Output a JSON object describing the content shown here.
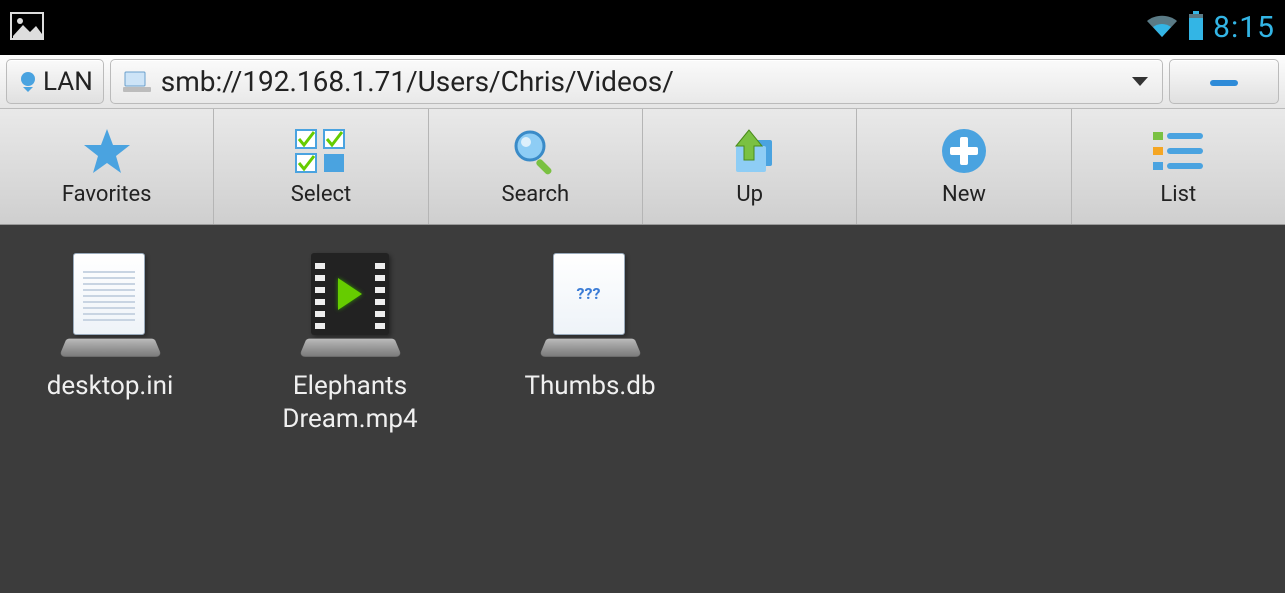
{
  "status": {
    "time": "8:15"
  },
  "address": {
    "lan_label": "LAN",
    "path": "smb://192.168.1.71/Users/Chris/Videos/"
  },
  "toolbar": [
    {
      "id": "favorites",
      "label": "Favorites"
    },
    {
      "id": "select",
      "label": "Select"
    },
    {
      "id": "search",
      "label": "Search"
    },
    {
      "id": "up",
      "label": "Up"
    },
    {
      "id": "new",
      "label": "New"
    },
    {
      "id": "list",
      "label": "List"
    }
  ],
  "files": [
    {
      "name": "desktop.ini",
      "kind": "document"
    },
    {
      "name": "Elephants Dream.mp4",
      "kind": "video"
    },
    {
      "name": "Thumbs.db",
      "kind": "unknown",
      "badge": "???"
    }
  ]
}
